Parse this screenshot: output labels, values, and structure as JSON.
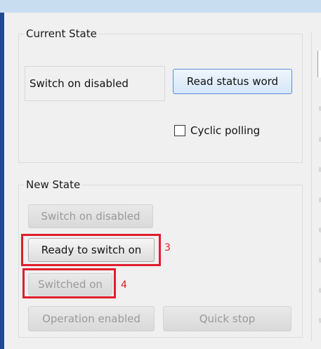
{
  "current_state": {
    "title": "Current State",
    "status_value": "Switch on disabled",
    "read_button": "Read status word",
    "cyclic_polling_label": "Cyclic polling",
    "cyclic_polling_checked": false
  },
  "new_state": {
    "title": "New State",
    "buttons": [
      {
        "label": "Switch on disabled",
        "enabled": false
      },
      {
        "label": "Ready to switch on",
        "enabled": true,
        "annotation": "3"
      },
      {
        "label": "Switched on",
        "enabled": false,
        "annotation": "4"
      },
      {
        "label": "Operation enabled",
        "enabled": false
      },
      {
        "label": "Quick stop",
        "enabled": false
      }
    ]
  },
  "colors": {
    "annotation": "#e01e2e",
    "window_bg": "#f0f0f0",
    "title_bar": "#c9ddf1",
    "frame_edge": "#1e4b8f"
  }
}
